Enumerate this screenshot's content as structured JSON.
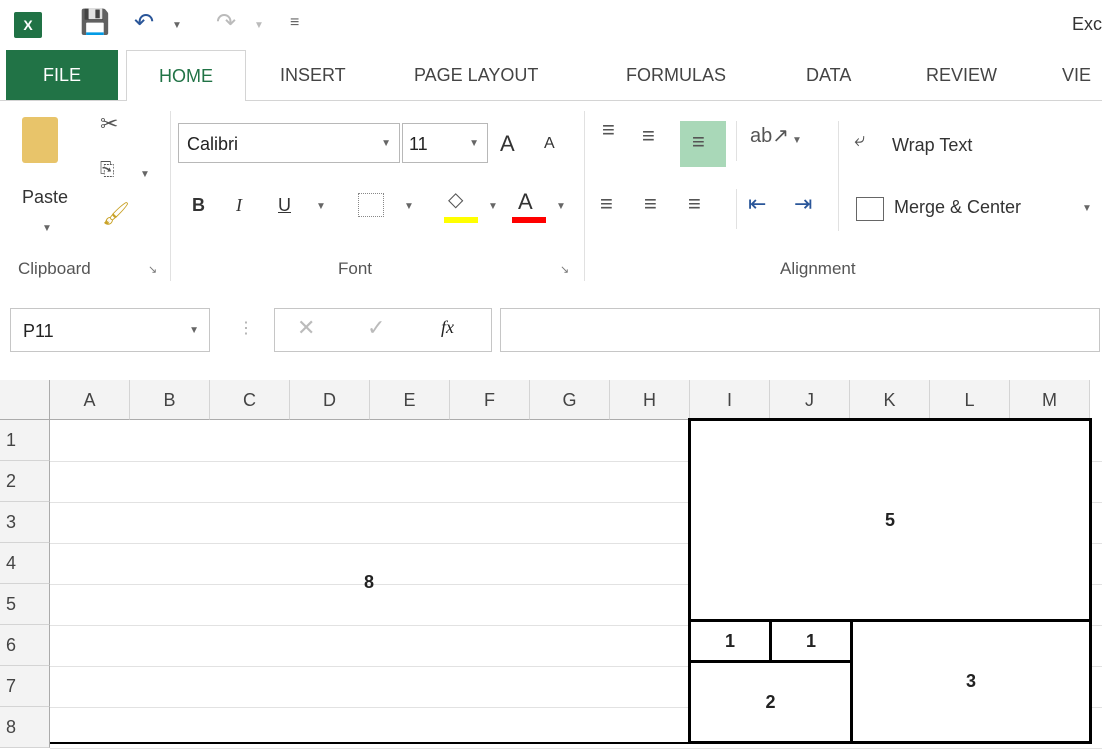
{
  "title": "Exc",
  "tabs": [
    "FILE",
    "HOME",
    "INSERT",
    "PAGE LAYOUT",
    "FORMULAS",
    "DATA",
    "REVIEW",
    "VIE"
  ],
  "clipboard": {
    "paste": "Paste",
    "label": "Clipboard"
  },
  "font": {
    "name": "Calibri",
    "size": "11",
    "label": "Font",
    "bold": "B",
    "italic": "I",
    "underline": "U",
    "grow": "A",
    "shrink": "A"
  },
  "alignment": {
    "wrap": "Wrap Text",
    "merge": "Merge & Center",
    "label": "Alignment"
  },
  "formula_bar": {
    "name_box": "P11",
    "fx": "fx",
    "value": ""
  },
  "columns": [
    "A",
    "B",
    "C",
    "D",
    "E",
    "F",
    "G",
    "H",
    "I",
    "J",
    "K",
    "L",
    "M"
  ],
  "rows": [
    "1",
    "2",
    "3",
    "4",
    "5",
    "6",
    "7",
    "8"
  ],
  "blocks": {
    "b8": "8",
    "b5": "5",
    "b1a": "1",
    "b1b": "1",
    "b2": "2",
    "b3": "3"
  },
  "colors": {
    "excel_green": "#217346",
    "fill_yellow": "#ffff00",
    "font_red": "#ff0000",
    "align_selected": "#a9d8b8"
  }
}
